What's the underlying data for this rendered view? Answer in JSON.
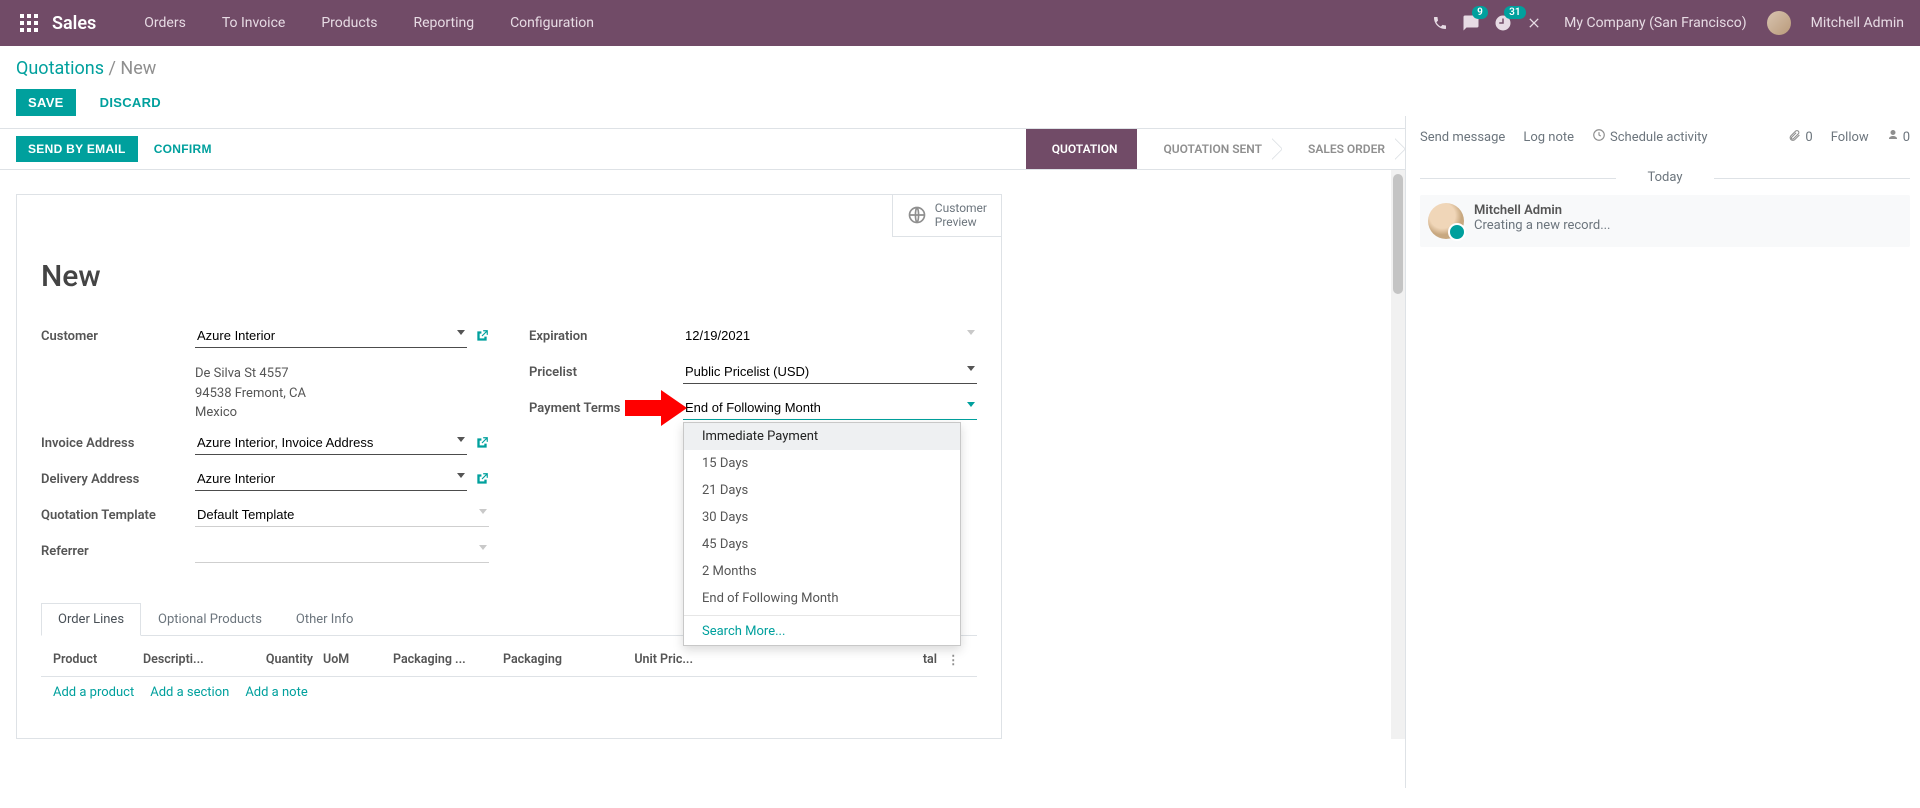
{
  "nav": {
    "brand": "Sales",
    "menu": [
      "Orders",
      "To Invoice",
      "Products",
      "Reporting",
      "Configuration"
    ],
    "msg_badge": "9",
    "activity_badge": "31",
    "company": "My Company (San Francisco)",
    "user": "Mitchell Admin"
  },
  "breadcrumb": {
    "root": "Quotations",
    "current": "New"
  },
  "buttons": {
    "save": "SAVE",
    "discard": "DISCARD",
    "send": "SEND BY EMAIL",
    "confirm": "CONFIRM"
  },
  "status": {
    "quotation": "QUOTATION",
    "sent": "QUOTATION SENT",
    "so": "SALES ORDER"
  },
  "sheet": {
    "customer_preview": "Customer\nPreview",
    "title": "New",
    "fields": {
      "customer_lbl": "Customer",
      "customer_val": "Azure Interior",
      "addr_line1": "De Silva St 4557",
      "addr_line2": "94538 Fremont, CA",
      "addr_line3": "Mexico",
      "invoice_addr_lbl": "Invoice Address",
      "invoice_addr_val": "Azure Interior, Invoice Address",
      "delivery_addr_lbl": "Delivery Address",
      "delivery_addr_val": "Azure Interior",
      "quote_tmpl_lbl": "Quotation Template",
      "quote_tmpl_val": "Default Template",
      "referrer_lbl": "Referrer",
      "referrer_val": "",
      "expiration_lbl": "Expiration",
      "expiration_val": "12/19/2021",
      "pricelist_lbl": "Pricelist",
      "pricelist_val": "Public Pricelist (USD)",
      "payment_terms_lbl": "Payment Terms",
      "payment_terms_val": "End of Following Month"
    },
    "payment_terms_options": [
      "Immediate Payment",
      "15 Days",
      "21 Days",
      "30 Days",
      "45 Days",
      "2 Months",
      "End of Following Month"
    ],
    "search_more": "Search More...",
    "tabs": {
      "order_lines": "Order Lines",
      "optional": "Optional Products",
      "other": "Other Info"
    },
    "cols": {
      "product": "Product",
      "desc": "Descripti...",
      "qty": "Quantity",
      "uom": "UoM",
      "pack_qty": "Packaging ...",
      "packaging": "Packaging",
      "unit_price": "Unit Pric...",
      "total_trunc": "tal"
    },
    "add": {
      "product": "Add a product",
      "section": "Add a section",
      "note": "Add a note"
    }
  },
  "chatter": {
    "send": "Send message",
    "log": "Log note",
    "schedule": "Schedule activity",
    "attach_count": "0",
    "follow": "Follow",
    "follow_count": "0",
    "today": "Today",
    "msg_name": "Mitchell Admin",
    "msg_body": "Creating a new record..."
  }
}
